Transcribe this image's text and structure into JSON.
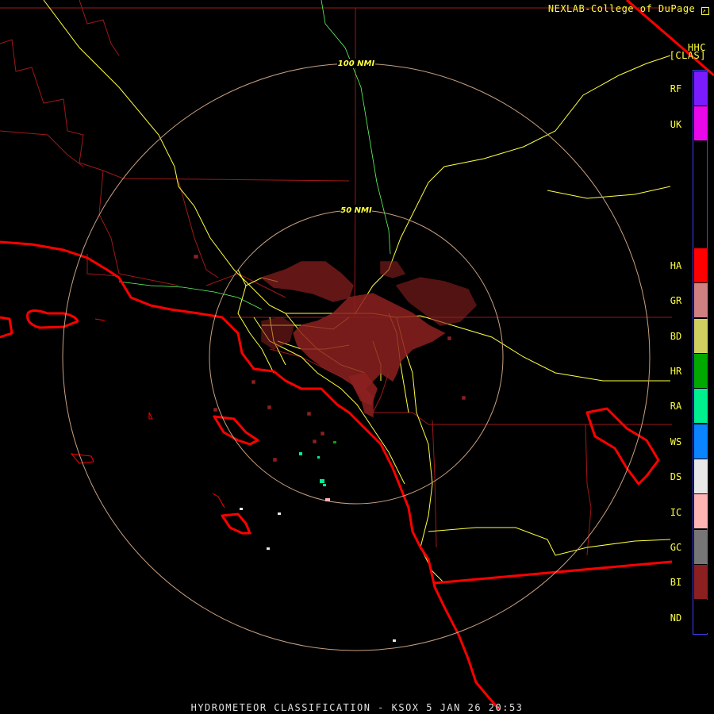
{
  "header": {
    "credit": "NEXLAB-College of DuPage",
    "credit_icon": "arrow-box-icon",
    "product": "HHC",
    "product_type": "[CLAS]"
  },
  "rings": {
    "outer_label": "100 NMI",
    "inner_label": "50 NMI"
  },
  "legend": {
    "items": [
      {
        "code": "RF",
        "color": "#7a1cff"
      },
      {
        "code": "UK",
        "color": "#ea08ea"
      },
      {
        "code": "HA",
        "color": "#ff0000"
      },
      {
        "code": "GR",
        "color": "#d08080"
      },
      {
        "code": "BD",
        "color": "#d0d060"
      },
      {
        "code": "HR",
        "color": "#00a800"
      },
      {
        "code": "RA",
        "color": "#00f090"
      },
      {
        "code": "WS",
        "color": "#0a84ff"
      },
      {
        "code": "DS",
        "color": "#e8e8e8"
      },
      {
        "code": "IC",
        "color": "#ffb4b4"
      },
      {
        "code": "GC",
        "color": "#767676"
      },
      {
        "code": "BI",
        "color": "#8c2020"
      },
      {
        "code": "ND",
        "color": "#000000"
      }
    ]
  },
  "footer": "HYDROMETEOR CLASSIFICATION - KSOX 5 JAN 26 20:53",
  "colors": {
    "coastline": "#ff0000",
    "county_lines": "#a01818",
    "highways": "#ffff40",
    "rivers": "#60ff60",
    "range_rings": "#c8a080",
    "biological_echo": "#8c2020"
  }
}
